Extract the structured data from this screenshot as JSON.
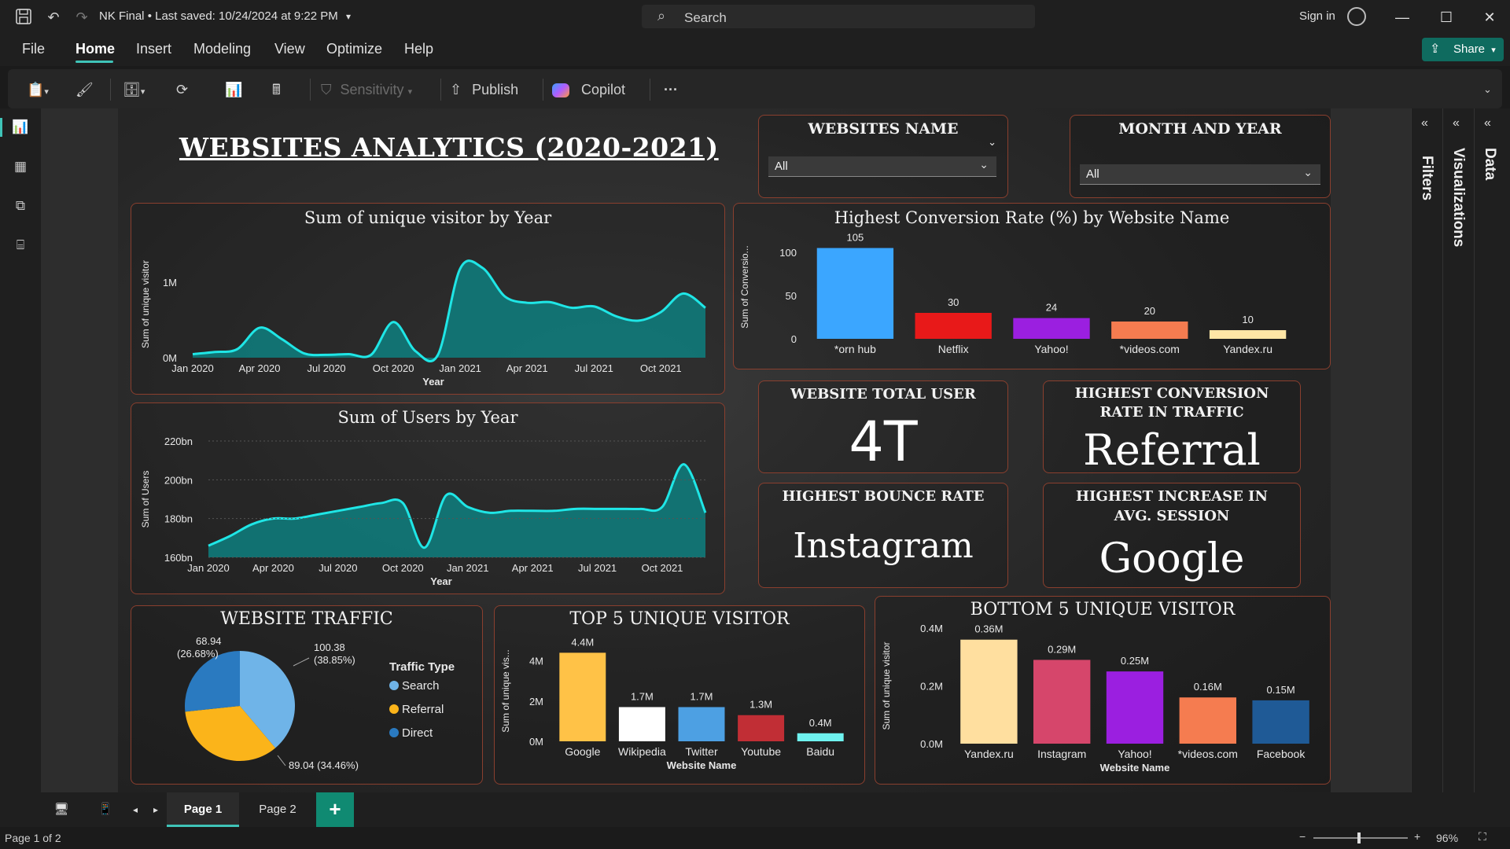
{
  "titlebar": {
    "doc_title": "NK Final",
    "saved": "Last saved: 10/24/2024 at 9:22 PM",
    "search_placeholder": "Search",
    "sign_in": "Sign in"
  },
  "menu": {
    "items": [
      "File",
      "Home",
      "Insert",
      "Modeling",
      "View",
      "Optimize",
      "Help"
    ],
    "active": "Home",
    "share": "Share"
  },
  "ribbon": {
    "sensitivity": "Sensitivity",
    "publish": "Publish",
    "copilot": "Copilot",
    "more": "···"
  },
  "panes": {
    "filters": "Filters",
    "visualizations": "Visualizations",
    "data": "Data"
  },
  "report": {
    "title": "WEBSITES  ANALYTICS (2020-2021)",
    "slicer_websites": {
      "title": "WEBSITES NAME",
      "value": "All"
    },
    "slicer_month": {
      "title": "MONTH AND YEAR",
      "value": "All"
    },
    "kpi_total_user": {
      "title": "WEBSITE TOTAL USER",
      "value": "4T"
    },
    "kpi_conversion": {
      "title": "HIGHEST CONVERSION RATE IN TRAFFIC",
      "value": "Referral"
    },
    "kpi_bounce": {
      "title": "HIGHEST BOUNCE RATE",
      "value": "Instagram"
    },
    "kpi_session": {
      "title": "HIGHEST INCREASE IN AVG. SESSION",
      "value": "Google"
    }
  },
  "chart_data": [
    {
      "id": "unique_visitor_by_year",
      "type": "area",
      "title": "Sum of unique visitor by Year",
      "xlabel": "Year",
      "ylabel": "Sum of unique visitor",
      "x_ticks": [
        "Jan 2020",
        "Apr 2020",
        "Jul 2020",
        "Oct 2020",
        "Jan 2021",
        "Apr 2021",
        "Jul 2021",
        "Oct 2021"
      ],
      "y_ticks": [
        "0M",
        "1M"
      ],
      "ylim": [
        0,
        1500000
      ],
      "x": [
        "2020-01",
        "2020-02",
        "2020-03",
        "2020-04",
        "2020-05",
        "2020-06",
        "2020-07",
        "2020-08",
        "2020-09",
        "2020-10",
        "2020-11",
        "2020-12",
        "2021-01",
        "2021-02",
        "2021-03",
        "2021-04",
        "2021-05",
        "2021-06",
        "2021-07",
        "2021-08",
        "2021-09",
        "2021-10",
        "2021-11",
        "2021-12"
      ],
      "values": [
        50000,
        80000,
        120000,
        420000,
        260000,
        60000,
        40000,
        50000,
        40000,
        500000,
        90000,
        40000,
        1250000,
        1260000,
        860000,
        770000,
        780000,
        700000,
        720000,
        580000,
        520000,
        640000,
        900000,
        700000
      ],
      "color": "#0e7f7f"
    },
    {
      "id": "users_by_year",
      "type": "area",
      "title": "Sum of Users by Year",
      "xlabel": "Year",
      "ylabel": "Sum of Users",
      "x_ticks": [
        "Jan 2020",
        "Apr 2020",
        "Jul 2020",
        "Oct 2020",
        "Jan 2021",
        "Apr 2021",
        "Jul 2021",
        "Oct 2021"
      ],
      "y_ticks": [
        "160bn",
        "180bn",
        "200bn",
        "220bn"
      ],
      "ylim": [
        160,
        220
      ],
      "x": [
        "2020-01",
        "2020-02",
        "2020-03",
        "2020-04",
        "2020-05",
        "2020-06",
        "2020-07",
        "2020-08",
        "2020-09",
        "2020-10",
        "2020-11",
        "2020-12",
        "2021-01",
        "2021-02",
        "2021-03",
        "2021-04",
        "2021-05",
        "2021-06",
        "2021-07",
        "2021-08",
        "2021-09",
        "2021-10",
        "2021-11",
        "2021-12"
      ],
      "values": [
        166,
        171,
        177,
        180,
        180,
        182,
        184,
        186,
        188,
        188,
        165,
        192,
        186,
        183,
        184,
        184,
        184,
        185,
        185,
        185,
        185,
        186,
        208,
        183
      ],
      "color": "#0e7f7f"
    },
    {
      "id": "conversion_rate_by_site",
      "type": "bar",
      "title": "Highest Conversion Rate (%) by Website Name",
      "ylabel": "Sum of Conversio...",
      "categories": [
        "*orn hub",
        "Netflix",
        "Yahoo!",
        "*videos.com",
        "Yandex.ru"
      ],
      "values": [
        105,
        30,
        24,
        20,
        10
      ],
      "data_labels": [
        "105",
        "30",
        "24",
        "20",
        "10"
      ],
      "colors": [
        "#3ba6ff",
        "#e81919",
        "#9b1fe0",
        "#f57c50",
        "#ffe6a6"
      ],
      "y_ticks": [
        "0",
        "50",
        "100"
      ],
      "ylim": [
        0,
        120
      ]
    },
    {
      "id": "website_traffic",
      "type": "pie",
      "title": "WEBSITE TRAFFIC",
      "legend_title": "Traffic Type",
      "labels": [
        "Search",
        "Referral",
        "Direct"
      ],
      "values": [
        100.38,
        89.04,
        68.94
      ],
      "data_labels": [
        "100.38\n(38.85%)",
        "89.04 (34.46%)",
        "68.94\n(26.68%)"
      ],
      "colors": [
        "#6fb4e8",
        "#fbb41a",
        "#2a7ac0"
      ]
    },
    {
      "id": "top5_unique_visitor",
      "type": "bar",
      "title": "TOP 5 UNIQUE VISITOR",
      "xlabel": "Website Name",
      "ylabel": "Sum of unique vis...",
      "categories": [
        "Google",
        "Wikipedia",
        "Twitter",
        "Youtube",
        "Baidu"
      ],
      "values": [
        4.4,
        1.7,
        1.7,
        1.3,
        0.4
      ],
      "data_labels": [
        "4.4M",
        "1.7M",
        "1.7M",
        "1.3M",
        "0.4M"
      ],
      "colors": [
        "#ffc247",
        "#ffffff",
        "#4da0e3",
        "#c12e35",
        "#6ff3f0"
      ],
      "y_ticks": [
        "0M",
        "2M",
        "4M"
      ],
      "ylim": [
        0,
        5
      ]
    },
    {
      "id": "bottom5_unique_visitor",
      "type": "bar",
      "title": "BOTTOM 5 UNIQUE VISITOR",
      "xlabel": "Website Name",
      "ylabel": "Sum of unique visitor",
      "categories": [
        "Yandex.ru",
        "Instagram",
        "Yahoo!",
        "*videos.com",
        "Facebook"
      ],
      "values": [
        0.36,
        0.29,
        0.25,
        0.16,
        0.15
      ],
      "data_labels": [
        "0.36M",
        "0.29M",
        "0.25M",
        "0.16M",
        "0.15M"
      ],
      "colors": [
        "#ffdf9f",
        "#d6466b",
        "#9b1fe0",
        "#f57c50",
        "#1f5a96"
      ],
      "y_ticks": [
        "0.0M",
        "0.2M",
        "0.4M"
      ],
      "ylim": [
        0,
        0.4
      ]
    }
  ],
  "pages": {
    "tabs": [
      "Page 1",
      "Page 2"
    ],
    "active": "Page 1"
  },
  "status": {
    "page_info": "Page 1 of 2",
    "zoom": "96%"
  }
}
